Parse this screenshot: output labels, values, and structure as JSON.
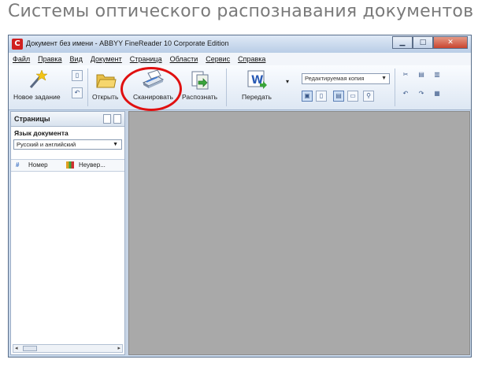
{
  "slide": {
    "title": "Системы оптического распознавания документов"
  },
  "window": {
    "title": "Документ без имени - ABBYY FineReader 10 Corporate Edition",
    "app_icon_letter": "C"
  },
  "menu": [
    "Файл",
    "Правка",
    "Вид",
    "Документ",
    "Страница",
    "Области",
    "Сервис",
    "Справка"
  ],
  "toolbar": {
    "new_task": "Новое задание",
    "open": "Открыть",
    "scan": "Сканировать",
    "recognize": "Распознать",
    "send": "Передать",
    "mode_select": "Редактируемая копия"
  },
  "left_pane": {
    "title": "Страницы",
    "doc_lang_label": "Язык документа",
    "doc_lang_value": "Русский и английский",
    "columns": [
      "#",
      "Номер",
      "Неувер..."
    ]
  },
  "icons": {
    "new_task": "wand-icon",
    "open": "folder-open-icon",
    "scan": "scanner-icon",
    "recognize": "recognize-icon",
    "send": "word-icon"
  },
  "colors": {
    "highlight": "#e01010",
    "workspace": "#a9a9a9",
    "chrome": "#c9d9ec"
  }
}
